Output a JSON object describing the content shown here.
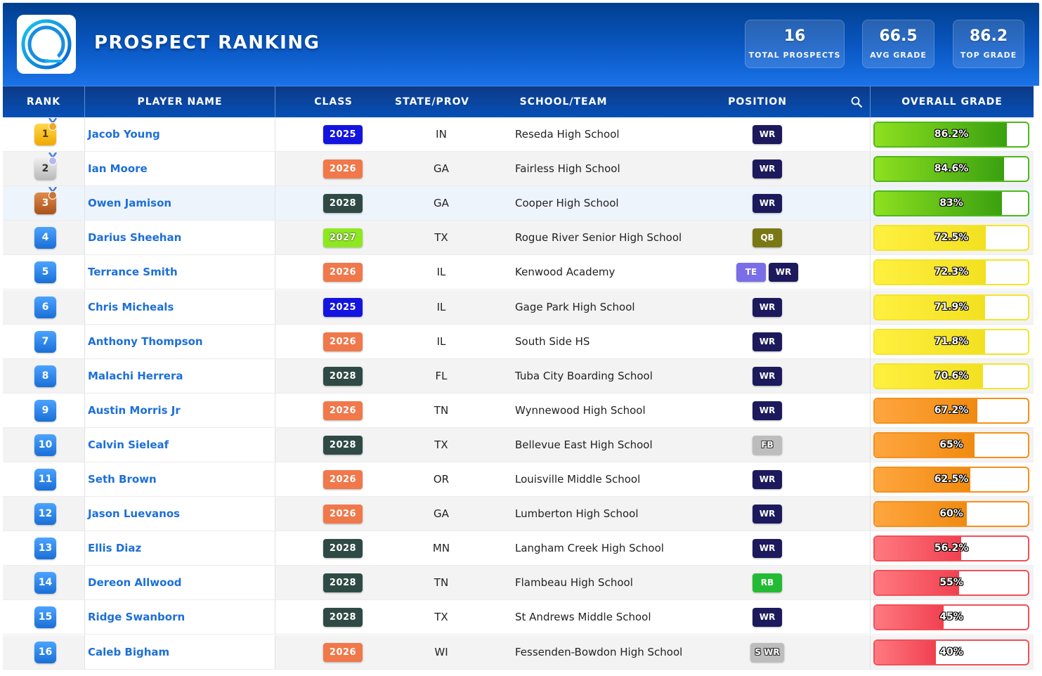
{
  "header": {
    "title": "PROSPECT RANKING",
    "stats": [
      {
        "value": "16",
        "label": "TOTAL PROSPECTS"
      },
      {
        "value": "66.5",
        "label": "AVG GRADE"
      },
      {
        "value": "86.2",
        "label": "TOP GRADE"
      }
    ]
  },
  "columns": {
    "rank": "RANK",
    "player": "PLAYER NAME",
    "class": "CLASS",
    "state": "STATE/PROV",
    "school": "SCHOOL/TEAM",
    "position": "POSITION",
    "grade": "OVERALL GRADE"
  },
  "colors": {
    "class": {
      "2025": "#1414e0",
      "2026": "#f0784a",
      "2027": "#8ee820",
      "2028": "#2f4a44"
    },
    "class_text": {
      "2027": "#2f4a10"
    },
    "position": {
      "WR": "#1c1a5c",
      "QB": "#7a7814",
      "TE": "#7a6ee8",
      "FB": "#bdbdbd",
      "RB": "#22bb33",
      "S WR": "#bdbdbd"
    },
    "grade_green": "#4db81a",
    "grade_yellow": "#f2e52a",
    "grade_orange": "#f5901a",
    "grade_red": "#f0505a"
  },
  "rows": [
    {
      "rank": "1",
      "medal": "gold",
      "name": "Jacob Young",
      "class": "2025",
      "state": "IN",
      "school": "Reseda High School",
      "positions": [
        "WR"
      ],
      "grade": 86.2,
      "grade_label": "86.2%",
      "tier": "green"
    },
    {
      "rank": "2",
      "medal": "silver",
      "name": "Ian Moore",
      "class": "2026",
      "state": "GA",
      "school": "Fairless High School",
      "positions": [
        "WR"
      ],
      "grade": 84.6,
      "grade_label": "84.6%",
      "tier": "green"
    },
    {
      "rank": "3",
      "medal": "bronze",
      "name": "Owen Jamison",
      "class": "2028",
      "state": "GA",
      "school": "Cooper High School",
      "positions": [
        "WR"
      ],
      "grade": 83,
      "grade_label": "83%",
      "tier": "green"
    },
    {
      "rank": "4",
      "medal": "",
      "name": "Darius Sheehan",
      "class": "2027",
      "state": "TX",
      "school": "Rogue River Senior High School",
      "positions": [
        "QB"
      ],
      "grade": 72.5,
      "grade_label": "72.5%",
      "tier": "yellow"
    },
    {
      "rank": "5",
      "medal": "",
      "name": "Terrance Smith",
      "class": "2026",
      "state": "IL",
      "school": "Kenwood Academy",
      "positions": [
        "TE",
        "WR"
      ],
      "grade": 72.3,
      "grade_label": "72.3%",
      "tier": "yellow"
    },
    {
      "rank": "6",
      "medal": "",
      "name": "Chris Micheals",
      "class": "2025",
      "state": "IL",
      "school": "Gage Park High School",
      "positions": [
        "WR"
      ],
      "grade": 71.9,
      "grade_label": "71.9%",
      "tier": "yellow"
    },
    {
      "rank": "7",
      "medal": "",
      "name": "Anthony Thompson",
      "class": "2026",
      "state": "IL",
      "school": "South Side HS",
      "positions": [
        "WR"
      ],
      "grade": 71.8,
      "grade_label": "71.8%",
      "tier": "yellow"
    },
    {
      "rank": "8",
      "medal": "",
      "name": "Malachi Herrera",
      "class": "2028",
      "state": "FL",
      "school": "Tuba City Boarding School",
      "positions": [
        "WR"
      ],
      "grade": 70.6,
      "grade_label": "70.6%",
      "tier": "yellow"
    },
    {
      "rank": "9",
      "medal": "",
      "name": "Austin Morris Jr",
      "class": "2026",
      "state": "TN",
      "school": "Wynnewood High School",
      "positions": [
        "WR"
      ],
      "grade": 67.2,
      "grade_label": "67.2%",
      "tier": "orange"
    },
    {
      "rank": "10",
      "medal": "",
      "name": "Calvin Sieleaf",
      "class": "2028",
      "state": "TX",
      "school": "Bellevue East High School",
      "positions": [
        "FB"
      ],
      "grade": 65,
      "grade_label": "65%",
      "tier": "orange"
    },
    {
      "rank": "11",
      "medal": "",
      "name": "Seth Brown",
      "class": "2026",
      "state": "OR",
      "school": "Louisville Middle School",
      "positions": [
        "WR"
      ],
      "grade": 62.5,
      "grade_label": "62.5%",
      "tier": "orange"
    },
    {
      "rank": "12",
      "medal": "",
      "name": "Jason Luevanos",
      "class": "2026",
      "state": "GA",
      "school": "Lumberton High School",
      "positions": [
        "WR"
      ],
      "grade": 60,
      "grade_label": "60%",
      "tier": "orange"
    },
    {
      "rank": "13",
      "medal": "",
      "name": "Ellis Diaz",
      "class": "2028",
      "state": "MN",
      "school": "Langham Creek High School",
      "positions": [
        "WR"
      ],
      "grade": 56.2,
      "grade_label": "56.2%",
      "tier": "red"
    },
    {
      "rank": "14",
      "medal": "",
      "name": "Dereon Allwood",
      "class": "2028",
      "state": "TN",
      "school": "Flambeau High School",
      "positions": [
        "RB"
      ],
      "grade": 55,
      "grade_label": "55%",
      "tier": "red"
    },
    {
      "rank": "15",
      "medal": "",
      "name": "Ridge Swanborn",
      "class": "2028",
      "state": "TX",
      "school": "St Andrews Middle School",
      "positions": [
        "WR"
      ],
      "grade": 45,
      "grade_label": "45%",
      "tier": "red"
    },
    {
      "rank": "16",
      "medal": "",
      "name": "Caleb Bigham",
      "class": "2026",
      "state": "WI",
      "school": "Fessenden-Bowdon High School",
      "positions": [
        "S WR"
      ],
      "grade": 40,
      "grade_label": "40%",
      "tier": "red"
    }
  ]
}
